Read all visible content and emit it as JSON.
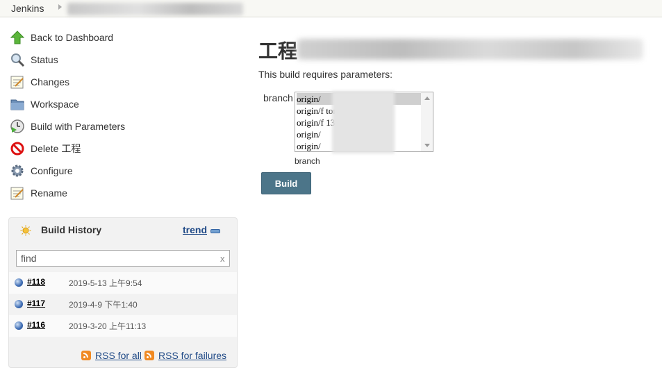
{
  "breadcrumb": {
    "root": "Jenkins"
  },
  "sidebar": {
    "items": [
      {
        "label": "Back to Dashboard",
        "icon": "up-arrow-icon"
      },
      {
        "label": "Status",
        "icon": "magnifier-icon"
      },
      {
        "label": "Changes",
        "icon": "notepad-icon"
      },
      {
        "label": "Workspace",
        "icon": "folder-icon"
      },
      {
        "label": "Build with Parameters",
        "icon": "clock-play-icon"
      },
      {
        "label": "Delete 工程",
        "icon": "no-entry-icon"
      },
      {
        "label": "Configure",
        "icon": "gear-icon"
      },
      {
        "label": "Rename",
        "icon": "notepad-icon"
      }
    ]
  },
  "build_history": {
    "title": "Build History",
    "trend": "trend",
    "find_value": "find",
    "clear": "x",
    "builds": [
      {
        "number": "#118",
        "date": "2019-5-13 上午9:54"
      },
      {
        "number": "#117",
        "date": "2019-4-9 下午1:40"
      },
      {
        "number": "#116",
        "date": "2019-3-20 上午11:13"
      }
    ],
    "rss_all": "RSS for all",
    "rss_failures": "RSS for failures"
  },
  "main": {
    "title": "工程",
    "requires_text": "This build requires parameters:",
    "param_name": "branch",
    "param_description": "branch",
    "options": [
      "origin/",
      "origin/f                       tor34",
      "origin/f                        13",
      "origin/",
      "origin/"
    ],
    "build_button": "Build"
  },
  "colors": {
    "link": "#204a87",
    "build_button": "#4c7589",
    "header_bg": "#f8f8f4"
  }
}
